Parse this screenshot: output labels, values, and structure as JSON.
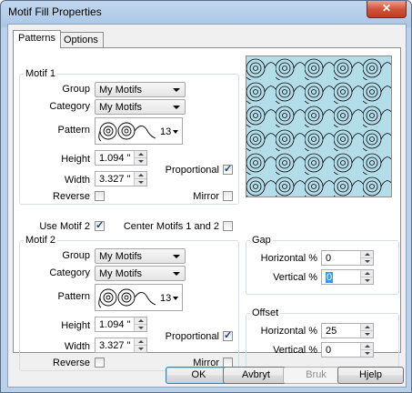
{
  "window": {
    "title": "Motif Fill Properties",
    "close_glyph": "✕"
  },
  "tabs": [
    {
      "label": "Patterns"
    },
    {
      "label": "Options"
    }
  ],
  "motif1": {
    "legend": "Motif 1",
    "group_label": "Group",
    "group_value": "My Motifs",
    "category_label": "Category",
    "category_value": "My Motifs",
    "pattern_label": "Pattern",
    "pattern_number": "13",
    "height_label": "Height",
    "height_value": "1.094 \"",
    "width_label": "Width",
    "width_value": "3.327 \"",
    "proportional_label": "Proportional",
    "proportional_checked": true,
    "reverse_label": "Reverse",
    "reverse_checked": false,
    "mirror_label": "Mirror",
    "mirror_checked": false
  },
  "use_motif2": {
    "label": "Use Motif 2",
    "checked": true
  },
  "center_motifs": {
    "label": "Center Motifs 1 and 2",
    "checked": false
  },
  "motif2": {
    "legend": "Motif 2",
    "group_label": "Group",
    "group_value": "My Motifs",
    "category_label": "Category",
    "category_value": "My Motifs",
    "pattern_label": "Pattern",
    "pattern_number": "13",
    "height_label": "Height",
    "height_value": "1.094 \"",
    "width_label": "Width",
    "width_value": "3.327 \"",
    "proportional_label": "Proportional",
    "proportional_checked": true,
    "reverse_label": "Reverse",
    "reverse_checked": false,
    "mirror_label": "Mirror",
    "mirror_checked": false
  },
  "gap": {
    "legend": "Gap",
    "horizontal_label": "Horizontal %",
    "horizontal_value": "0",
    "vertical_label": "Vertical %",
    "vertical_value": "0"
  },
  "offset": {
    "legend": "Offset",
    "horizontal_label": "Horizontal %",
    "horizontal_value": "25",
    "vertical_label": "Vertical %",
    "vertical_value": "0"
  },
  "buttons": {
    "ok": "OK",
    "cancel": "Avbryt",
    "apply": "Bruk",
    "help": "Hjelp"
  },
  "colors": {
    "preview_bg": "#b3dde8",
    "selection": "#3399ff"
  }
}
